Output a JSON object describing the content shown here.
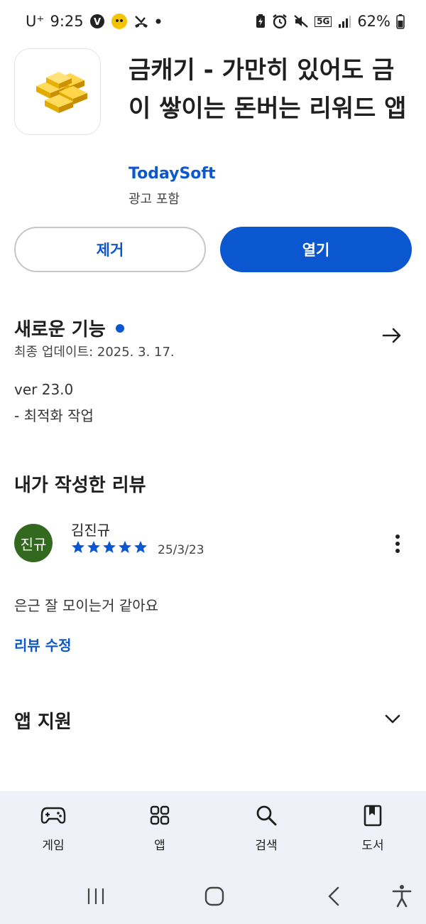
{
  "status_bar": {
    "carrier": "U⁺",
    "time": "9:25",
    "battery": "62%",
    "network": "5G"
  },
  "app": {
    "title": "금캐기 - 가만히 있어도 금이 쌓이는 돈버는 리워드 앱",
    "developer": "TodaySoft",
    "ads_notice": "광고 포함",
    "remove_label": "제거",
    "open_label": "열기"
  },
  "whats_new": {
    "title": "새로운 기능",
    "last_updated": "최종 업데이트: 2025. 3. 17.",
    "version": "ver 23.0",
    "notes": "- 최적화 작업"
  },
  "my_review": {
    "title": "내가 작성한 리뷰",
    "avatar_text": "진규",
    "reviewer_name": "김진규",
    "rating": 5,
    "date": "25/3/23",
    "text": "은근 잘 모이는거 같아요",
    "edit_label": "리뷰 수정"
  },
  "app_support": {
    "title": "앱 지원"
  },
  "bottom_nav": {
    "items": [
      {
        "label": "게임",
        "icon": "gamepad-icon"
      },
      {
        "label": "앱",
        "icon": "apps-grid-icon"
      },
      {
        "label": "검색",
        "icon": "search-icon"
      },
      {
        "label": "도서",
        "icon": "book-icon"
      }
    ]
  },
  "colors": {
    "accent": "#0b57d0",
    "avatar_bg": "#33691e",
    "nav_bg": "#eef1f7"
  }
}
